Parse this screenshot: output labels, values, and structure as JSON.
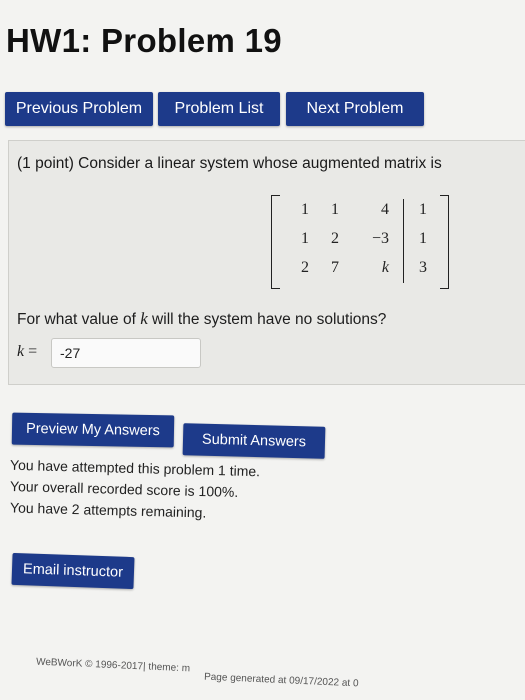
{
  "page": {
    "title": "HW1: Problem 19"
  },
  "nav": {
    "previous": "Previous Problem",
    "list": "Problem List",
    "next": "Next Problem"
  },
  "problem": {
    "statement": "(1 point) Consider a linear system whose augmented matrix is",
    "matrix": [
      [
        "1",
        "1",
        "4",
        "1"
      ],
      [
        "1",
        "2",
        "−3",
        "1"
      ],
      [
        "2",
        "7",
        "k",
        "3"
      ]
    ],
    "question_prefix": "For what value of ",
    "question_var": "k",
    "question_suffix": " will the system have no solutions?",
    "answer_label_var": "k",
    "answer_label_eq": " =",
    "answer_value": "-27"
  },
  "actions": {
    "preview": "Preview My Answers",
    "submit": "Submit Answers"
  },
  "status": {
    "attempted": "You have attempted this problem 1 time.",
    "score": "Your overall recorded score is 100%.",
    "remaining": "You have 2 attempts remaining."
  },
  "email": {
    "label": "Email instructor"
  },
  "footer": {
    "copyright": "WeBWorK © 1996-2017| theme: m",
    "generated": "Page generated at 09/17/2022 at 0"
  }
}
